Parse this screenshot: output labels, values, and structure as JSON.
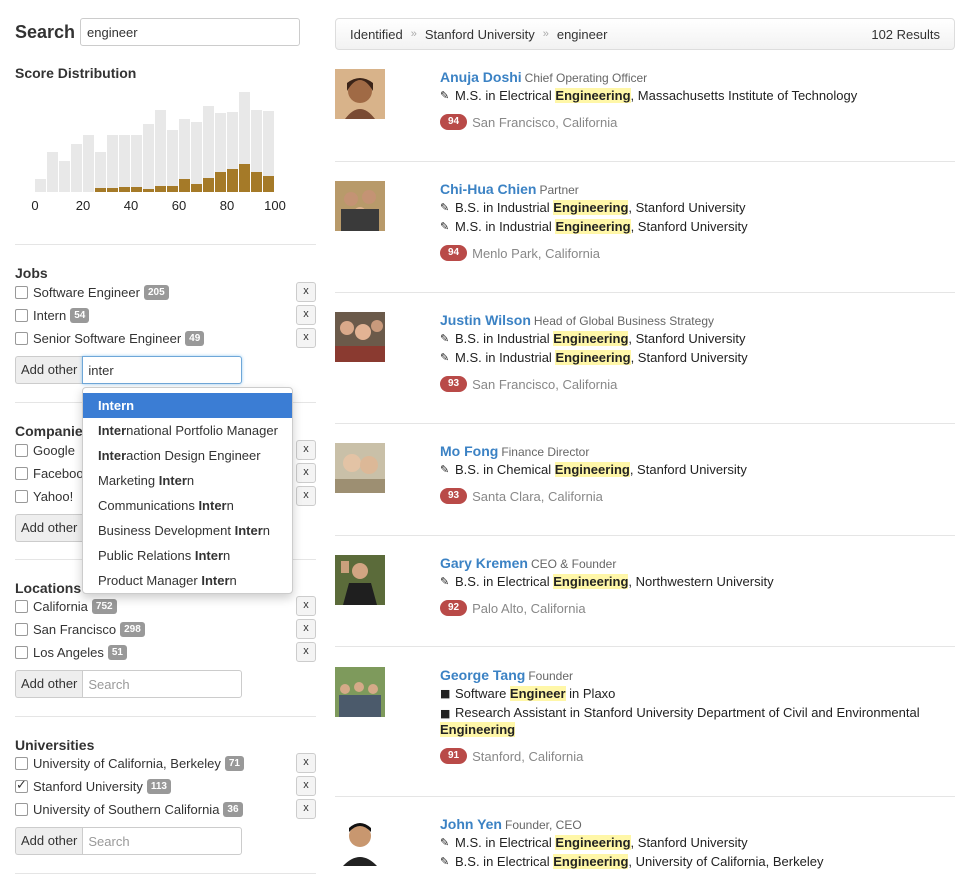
{
  "search": {
    "title": "Search",
    "value": "engineer"
  },
  "score_distribution": {
    "title": "Score Distribution",
    "ticks": [
      "0",
      "20",
      "40",
      "60",
      "80",
      "100"
    ],
    "totals": [
      0.13,
      0.39,
      0.3,
      0.47,
      0.56,
      0.39,
      0.56,
      0.56,
      0.56,
      0.67,
      0.8,
      0.61,
      0.72,
      0.69,
      0.84,
      0.77,
      0.78,
      0.98,
      0.8,
      0.79
    ],
    "matches": [
      0,
      0,
      0,
      0,
      0,
      0.04,
      0.04,
      0.05,
      0.05,
      0.03,
      0.06,
      0.06,
      0.13,
      0.08,
      0.14,
      0.2,
      0.23,
      0.27,
      0.2,
      0.16
    ],
    "colors": {
      "total": "#e8e8e8",
      "match": "#a57a28"
    }
  },
  "jobs": {
    "title": "Jobs",
    "items": [
      {
        "label": "Software Engineer",
        "count": "205",
        "checked": false
      },
      {
        "label": "Intern",
        "count": "54",
        "checked": false
      },
      {
        "label": "Senior Software Engineer",
        "count": "49",
        "checked": false
      }
    ],
    "add_label": "Add other",
    "add_value": "inter"
  },
  "dropdown": {
    "items": [
      {
        "pre": "",
        "bold": "Intern",
        "post": ""
      },
      {
        "pre": "",
        "bold": "Inter",
        "post": "national Portfolio Manager"
      },
      {
        "pre": "",
        "bold": "Inter",
        "post": "action Design Engineer"
      },
      {
        "pre": "Marketing ",
        "bold": "Inter",
        "post": "n"
      },
      {
        "pre": "Communications ",
        "bold": "Inter",
        "post": "n"
      },
      {
        "pre": "Business Development ",
        "bold": "Inter",
        "post": "n"
      },
      {
        "pre": "Public Relations ",
        "bold": "Inter",
        "post": "n"
      },
      {
        "pre": "Product Manager ",
        "bold": "Inter",
        "post": "n"
      }
    ]
  },
  "companies": {
    "title": "Companies",
    "items": [
      {
        "label": "Google",
        "count": "",
        "checked": false
      },
      {
        "label": "Facebook",
        "count": "",
        "checked": false
      },
      {
        "label": "Yahoo!",
        "count": "",
        "checked": false
      }
    ],
    "add_label": "Add other"
  },
  "locations": {
    "title": "Locations",
    "items": [
      {
        "label": "California",
        "count": "752",
        "checked": false
      },
      {
        "label": "San Francisco",
        "count": "298",
        "checked": false
      },
      {
        "label": "Los Angeles",
        "count": "51",
        "checked": false
      }
    ],
    "add_label": "Add other",
    "add_placeholder": "Search"
  },
  "universities": {
    "title": "Universities",
    "items": [
      {
        "label": "University of California, Berkeley",
        "count": "71",
        "checked": false
      },
      {
        "label": "Stanford University",
        "count": "113",
        "checked": true
      },
      {
        "label": "University of Southern California",
        "count": "36",
        "checked": false
      }
    ],
    "add_label": "Add other",
    "add_placeholder": "Search"
  },
  "remove_label": "x",
  "breadcrumb": {
    "items": [
      "Identified",
      "Stanford University",
      "engineer"
    ],
    "sep": "»",
    "results": "102 Results"
  },
  "results": [
    {
      "name": "Anuja Doshi",
      "title": "Chief Operating Officer",
      "lines": [
        {
          "icon": "pencil-icon",
          "pre": "M.S. in Electrical ",
          "hl": "Engineering",
          "post": ", Massachusetts Institute of Technology"
        }
      ],
      "score": "94",
      "location": "San Francisco, California"
    },
    {
      "name": "Chi-Hua Chien",
      "title": "Partner",
      "lines": [
        {
          "icon": "pencil-icon",
          "pre": "B.S. in Industrial ",
          "hl": "Engineering",
          "post": ", Stanford University"
        },
        {
          "icon": "pencil-icon",
          "pre": "M.S. in Industrial ",
          "hl": "Engineering",
          "post": ", Stanford University"
        }
      ],
      "score": "94",
      "location": "Menlo Park, California"
    },
    {
      "name": "Justin Wilson",
      "title": "Head of Global Business Strategy",
      "lines": [
        {
          "icon": "pencil-icon",
          "pre": "B.S. in Industrial ",
          "hl": "Engineering",
          "post": ", Stanford University"
        },
        {
          "icon": "pencil-icon",
          "pre": "M.S. in Industrial ",
          "hl": "Engineering",
          "post": ", Stanford University"
        }
      ],
      "score": "93",
      "location": "San Francisco, California"
    },
    {
      "name": "Mo Fong",
      "title": "Finance Director",
      "lines": [
        {
          "icon": "pencil-icon",
          "pre": "B.S. in Chemical ",
          "hl": "Engineering",
          "post": ", Stanford University"
        }
      ],
      "score": "93",
      "location": "Santa Clara, California"
    },
    {
      "name": "Gary Kremen",
      "title": "CEO & Founder",
      "lines": [
        {
          "icon": "pencil-icon",
          "pre": "B.S. in Electrical ",
          "hl": "Engineering",
          "post": ", Northwestern University"
        }
      ],
      "score": "92",
      "location": "Palo Alto, California"
    },
    {
      "name": "George Tang",
      "title": "Founder",
      "lines": [
        {
          "icon": "briefcase-icon",
          "pre": "Software ",
          "hl": "Engineer",
          "post": " in Plaxo"
        },
        {
          "icon": "briefcase-icon",
          "pre": "Research Assistant in Stanford University Department of Civil and Environmental ",
          "hl": "Engineering",
          "post": ""
        }
      ],
      "score": "91",
      "location": "Stanford, California"
    },
    {
      "name": "John Yen",
      "title": "Founder, CEO",
      "lines": [
        {
          "icon": "pencil-icon",
          "pre": "M.S. in Electrical ",
          "hl": "Engineering",
          "post": ", Stanford University"
        },
        {
          "icon": "pencil-icon",
          "pre": "B.S. in Electrical ",
          "hl": "Engineering",
          "post": ", University of California, Berkeley"
        }
      ],
      "score": "",
      "location": ""
    }
  ]
}
